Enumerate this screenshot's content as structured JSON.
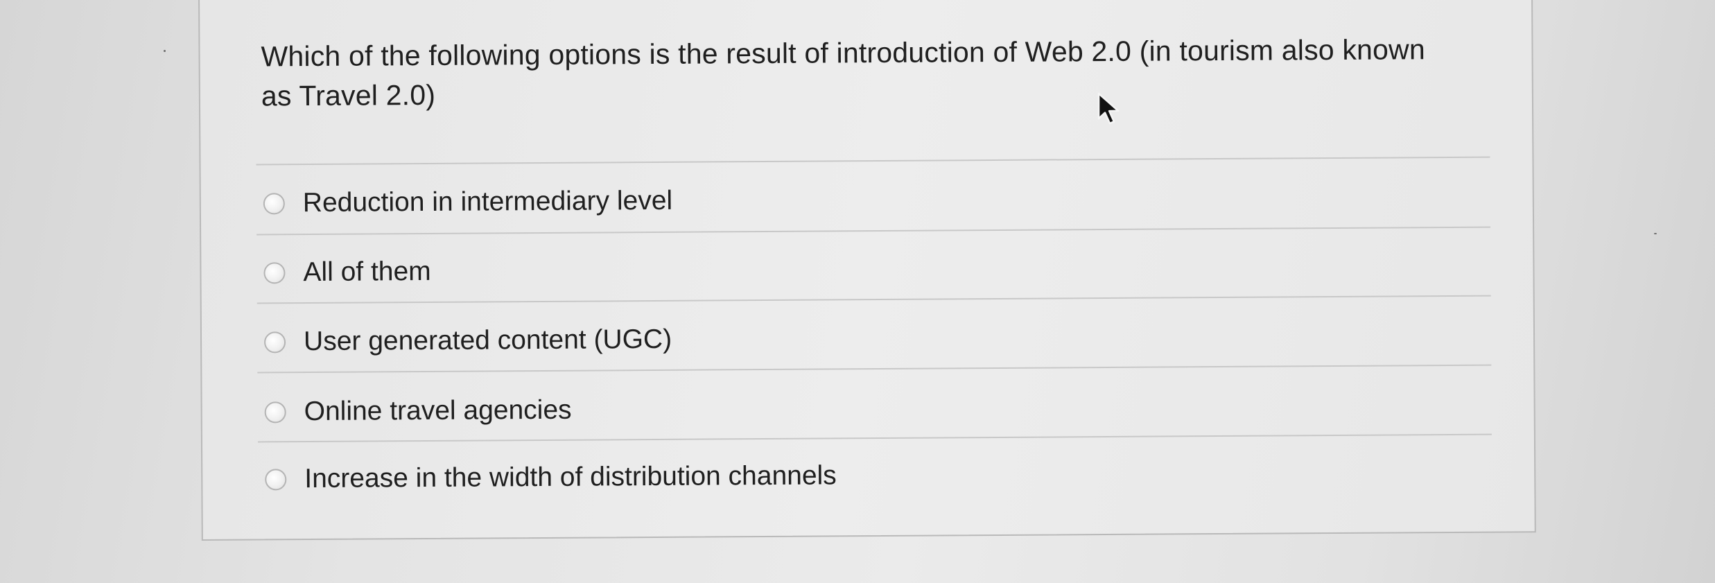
{
  "quiz": {
    "question": "Which of the following options is the result of introduction of Web 2.0 (in tourism also known as Travel 2.0)",
    "options": [
      {
        "label": "Reduction in intermediary level",
        "selected": false
      },
      {
        "label": "All of them",
        "selected": false
      },
      {
        "label": "User generated content (UGC)",
        "selected": false
      },
      {
        "label": "Online travel agencies",
        "selected": false
      },
      {
        "label": "Increase in the width of distribution channels",
        "selected": false
      }
    ]
  },
  "cursor": {
    "icon": "arrow-pointer-icon"
  }
}
